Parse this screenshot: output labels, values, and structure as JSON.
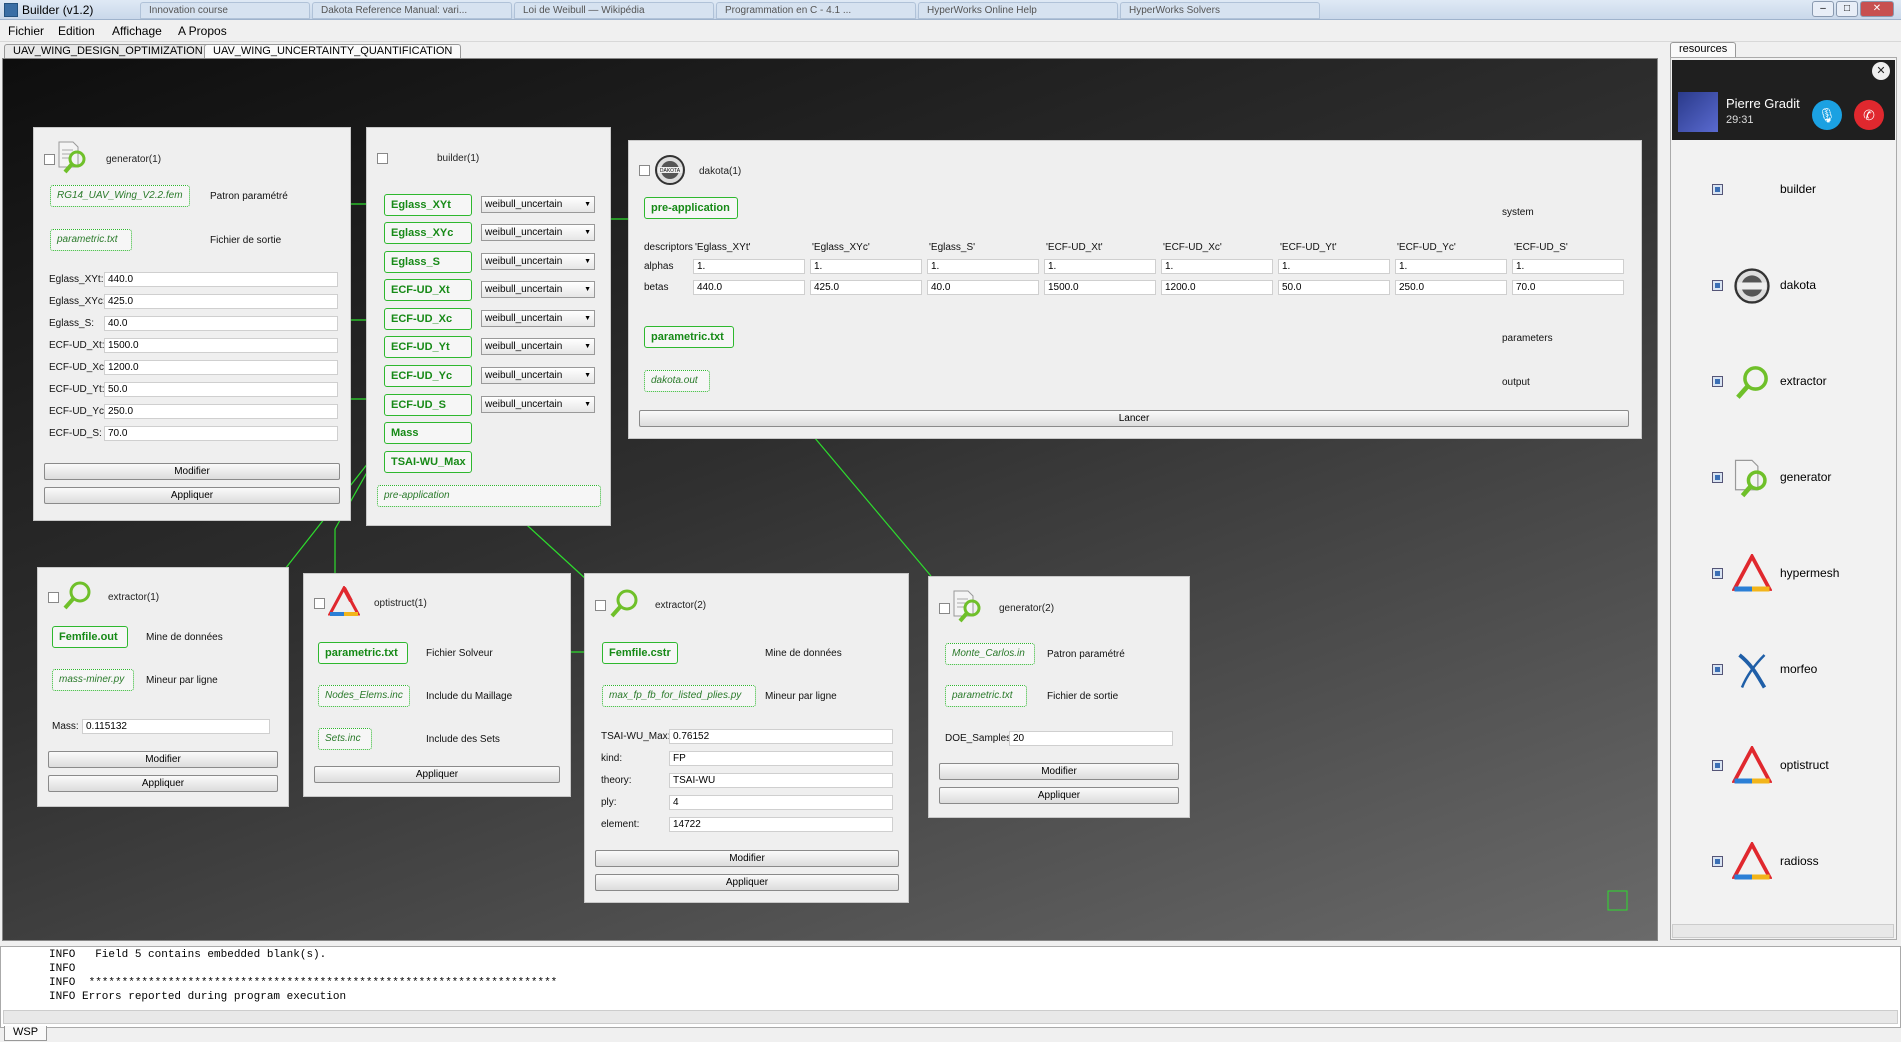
{
  "window": {
    "title": "Builder (v1.2)"
  },
  "browser_tabs": [
    "Innovation course",
    "Dakota Reference Manual: vari...",
    "Loi de Weibull — Wikipédia",
    "Programmation en C - 4.1 ...",
    "HyperWorks Online Help",
    "HyperWorks Solvers"
  ],
  "menu": [
    "Fichier",
    "Edition",
    "Affichage",
    "A Propos"
  ],
  "tabs": [
    "UAV_WING_DESIGN_OPTIMIZATION",
    "UAV_WING_UNCERTAINTY_QUANTIFICATION"
  ],
  "generator1": {
    "title": "generator(1)",
    "template_file": "RG14_UAV_Wing_V2.2.fem",
    "template_label": "Patron paramétré",
    "output_file": "parametric.txt",
    "output_label": "Fichier de sortie",
    "params": [
      {
        "label": "Eglass_XYt:",
        "value": "440.0"
      },
      {
        "label": "Eglass_XYc:",
        "value": "425.0"
      },
      {
        "label": "Eglass_S:",
        "value": "40.0"
      },
      {
        "label": "ECF-UD_Xt:",
        "value": "1500.0"
      },
      {
        "label": "ECF-UD_Xc:",
        "value": "1200.0"
      },
      {
        "label": "ECF-UD_Yt:",
        "value": "50.0"
      },
      {
        "label": "ECF-UD_Yc:",
        "value": "250.0"
      },
      {
        "label": "ECF-UD_S:",
        "value": "70.0"
      }
    ],
    "modify": "Modifier",
    "apply": "Appliquer"
  },
  "builder1": {
    "title": "builder(1)",
    "rows": [
      {
        "port": "Eglass_XYt",
        "combo": "weibull_uncertain"
      },
      {
        "port": "Eglass_XYc",
        "combo": "weibull_uncertain"
      },
      {
        "port": "Eglass_S",
        "combo": "weibull_uncertain"
      },
      {
        "port": "ECF-UD_Xt",
        "combo": "weibull_uncertain"
      },
      {
        "port": "ECF-UD_Xc",
        "combo": "weibull_uncertain"
      },
      {
        "port": "ECF-UD_Yt",
        "combo": "weibull_uncertain"
      },
      {
        "port": "ECF-UD_Yc",
        "combo": "weibull_uncertain"
      },
      {
        "port": "ECF-UD_S",
        "combo": "weibull_uncertain"
      }
    ],
    "mass": "Mass",
    "tsai": "TSAI-WU_Max",
    "pre": "pre-application"
  },
  "dakota1": {
    "title": "dakota(1)",
    "pre": "pre-application",
    "system": "system",
    "descriptors_label": "descriptors",
    "alphas_label": "alphas",
    "betas_label": "betas",
    "descriptors": [
      "'Eglass_XYt'",
      "'Eglass_XYc'",
      "'Eglass_S'",
      "'ECF-UD_Xt'",
      "'ECF-UD_Xc'",
      "'ECF-UD_Yt'",
      "'ECF-UD_Yc'",
      "'ECF-UD_S'"
    ],
    "alphas": [
      "1.",
      "1.",
      "1.",
      "1.",
      "1.",
      "1.",
      "1.",
      "1."
    ],
    "betas": [
      "440.0",
      "425.0",
      "40.0",
      "1500.0",
      "1200.0",
      "50.0",
      "250.0",
      "70.0"
    ],
    "params_file": "parametric.txt",
    "params_label": "parameters",
    "output_file": "dakota.out",
    "output_label": "output",
    "run": "Lancer"
  },
  "extractor1": {
    "title": "extractor(1)",
    "file": "Femfile.out",
    "file_label": "Mine de données",
    "script": "mass-miner.py",
    "script_label": "Mineur par ligne",
    "mass_label": "Mass:",
    "mass_value": "0.115132",
    "modify": "Modifier",
    "apply": "Appliquer"
  },
  "optistruct1": {
    "title": "optistruct(1)",
    "file": "parametric.txt",
    "file_label": "Fichier Solveur",
    "mesh": "Nodes_Elems.inc",
    "mesh_label": "Include du Maillage",
    "sets": "Sets.inc",
    "sets_label": "Include des Sets",
    "apply": "Appliquer"
  },
  "extractor2": {
    "title": "extractor(2)",
    "file": "Femfile.cstr",
    "file_label": "Mine de données",
    "script": "max_fp_fb_for_listed_plies.py",
    "script_label": "Mineur par ligne",
    "fields": [
      {
        "label": "TSAI-WU_Max:",
        "value": "0.76152"
      },
      {
        "label": "kind:",
        "value": "FP"
      },
      {
        "label": "theory:",
        "value": "TSAI-WU"
      },
      {
        "label": "ply:",
        "value": "4"
      },
      {
        "label": "element:",
        "value": "14722"
      }
    ],
    "modify": "Modifier",
    "apply": "Appliquer"
  },
  "generator2": {
    "title": "generator(2)",
    "template_file": "Monte_Carlos.in",
    "template_label": "Patron paramétré",
    "output_file": "parametric.txt",
    "output_label": "Fichier de sortie",
    "doe_label": "DOE_Samples:",
    "doe_value": "20",
    "modify": "Modifier",
    "apply": "Appliquer"
  },
  "resources": {
    "tab": "resources",
    "call": {
      "name": "Pierre Gradit",
      "time": "29:31"
    },
    "items": [
      "builder",
      "dakota",
      "extractor",
      "generator",
      "hypermesh",
      "morfeo",
      "optistruct",
      "radioss"
    ]
  },
  "console": {
    "lines": [
      "INFO   Field 5 contains embedded blank(s).",
      "INFO",
      "INFO  ***********************************************************************",
      "INFO Errors reported during program execution"
    ],
    "tab": "WSP"
  },
  "colors": {
    "accent_green": "#2eb82e",
    "call_blue": "#1ba1e2",
    "hangup_red": "#e0282e"
  }
}
